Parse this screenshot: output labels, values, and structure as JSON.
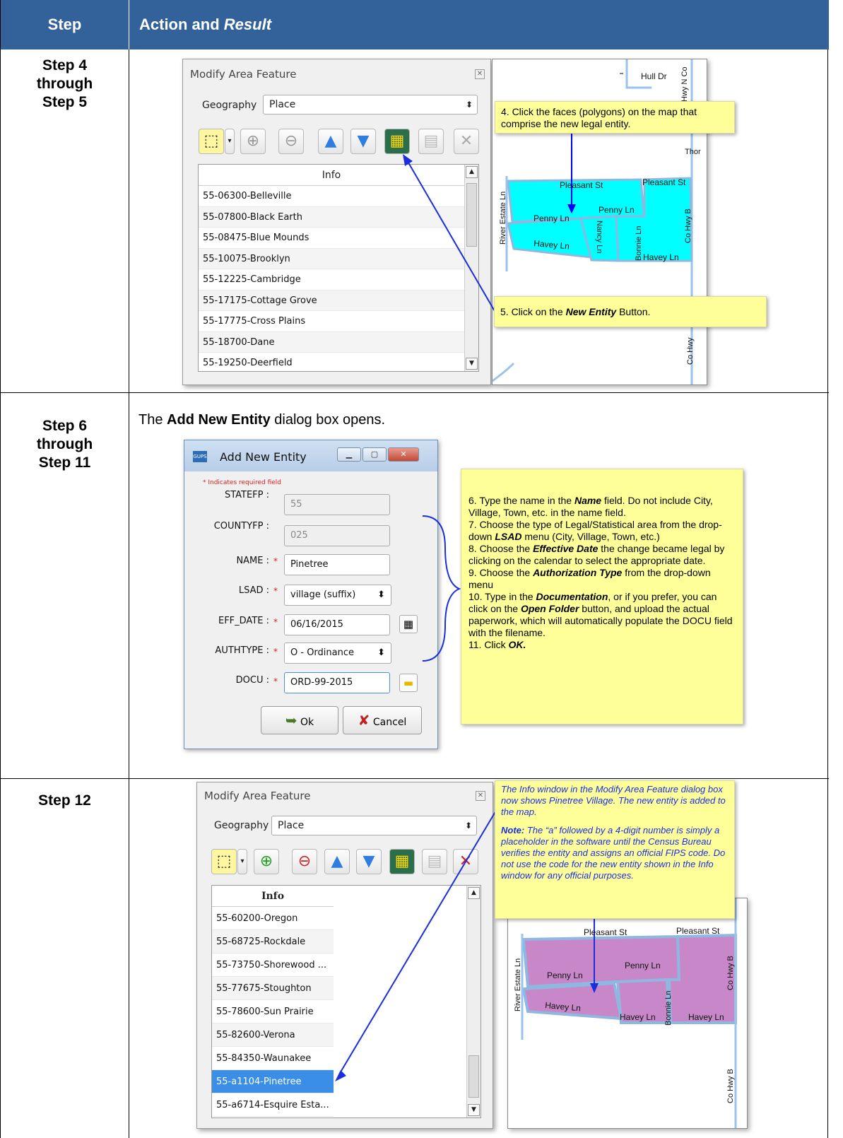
{
  "header": {
    "step": "Step",
    "action_plain": "Action and ",
    "action_italic": "Result"
  },
  "rows": [
    {
      "step_lines": [
        "Step 4",
        "through",
        "Step 5"
      ]
    },
    {
      "step_lines": [
        "Step 6",
        "through",
        "Step 11"
      ]
    },
    {
      "step_lines": [
        "Step 12"
      ]
    }
  ],
  "dialog1": {
    "title": "Modify Area Feature",
    "geography_label": "Geography",
    "geography_value": "Place",
    "list_header": "Info",
    "items": [
      "55-06300-Belleville",
      "55-07800-Black Earth",
      "55-08475-Blue Mounds",
      "55-10075-Brooklyn",
      "55-12225-Cambridge",
      "55-17175-Cottage Grove",
      "55-17775-Cross Plains",
      "55-18700-Dane",
      "55-19250-Deerfield"
    ]
  },
  "map1": {
    "labels": {
      "hull": "Hull Dr",
      "hwy_n": "Hwy N Co",
      "thor": "Thor",
      "pleasant1": "Pleasant St",
      "pleasant2": "Pleasant St",
      "river": "River Estate Ln",
      "penny1": "Penny Ln",
      "penny2": "Penny Ln",
      "nancy": "Nancy Ln",
      "bonnie": "Bonnie Ln",
      "cohwyb": "Co Hwy B",
      "havey1": "Havey Ln",
      "havey2": "Havey Ln",
      "cohwy": "Co Hwy"
    }
  },
  "callouts": {
    "c4": "4.  Click the faces (polygons) on the map that comprise the new legal entity.",
    "c5_pre": "5.  Click on the ",
    "c5_bold": "New Entity",
    "c5_post": " Button."
  },
  "row2": {
    "intro_pre": "The ",
    "intro_bold": "Add New Entity",
    "intro_post": " dialog box opens."
  },
  "add_dialog": {
    "title": "Add New Entity",
    "icon": "GUPS",
    "required_note": "* Indicates required field",
    "fields": [
      {
        "label": "STATEFP :",
        "value": "55"
      },
      {
        "label": "COUNTYFP :",
        "value": "025"
      },
      {
        "label": "NAME :",
        "value": "Pinetree"
      },
      {
        "label": "LSAD :",
        "value": "village (suffix)"
      },
      {
        "label": "EFF_DATE :",
        "value": "06/16/2015"
      },
      {
        "label": "AUTHTYPE :",
        "value": "O - Ordinance"
      },
      {
        "label": "DOCU :",
        "value": "ORD-99-2015"
      }
    ],
    "ok": "Ok",
    "cancel": "Cancel",
    "req_mark": "*"
  },
  "instructions": {
    "l1_pre": "6. Type the name in the ",
    "l1_b": "Name",
    "l1_post": " field. Do not include City, Village, Town, etc. in the name field.",
    "l2_pre": "7. Choose the type of Legal/Statistical  area from the drop-down ",
    "l2_b": "LSAD",
    "l2_post": " menu (City, Village, Town, etc.)",
    "l3_pre": "8. Choose the ",
    "l3_b": "Effective Date",
    "l3_post": " the change became legal by clicking on the calendar to select the appropriate date.",
    "l4_pre": "9. Choose the ",
    "l4_b": "Authorization Type",
    "l4_post": " from the drop-down menu",
    "l5_pre": "10. Type in the ",
    "l5_b": "Documentation",
    "l5_mid": ", or if you prefer, you can click on the ",
    "l5_b2": "Open Folder",
    "l5_post": " button, and upload the actual paperwork, which will automatically populate the DOCU field with the filename.",
    "l6_pre": "11. Click ",
    "l6_b": "OK."
  },
  "dialog3": {
    "title": "Modify Area Feature",
    "geography_label": "Geography",
    "geography_value": "Place",
    "list_header": "Info",
    "items": [
      "55-60200-Oregon",
      "55-68725-Rockdale",
      "55-73750-Shorewood ...",
      "55-77675-Stoughton",
      "55-78600-Sun Prairie",
      "55-82600-Verona",
      "55-84350-Waunakee",
      "55-a1104-Pinetree",
      "55-a6714-Esquire Esta..."
    ]
  },
  "note3": {
    "p1": "The Info window in the Modify Area Feature dialog box now shows Pinetree Village. The new entity is added to the map.",
    "p2_b": "Note:",
    "p2": " The “a” followed by a 4-digit number is simply a placeholder in the software until the Census Bureau verifies the entity and assigns an official FIPS code. Do not use the code for the new entity shown in the Info window for any official purposes."
  },
  "map3": {
    "labels": {
      "pleasant1": "Pleasant St",
      "pleasant2": "Pleasant St",
      "river": "River Estate Ln",
      "penny1": "Penny Ln",
      "penny2": "Penny Ln",
      "bonnie": "Bonnie Ln",
      "cohwyb": "Co Hwy B",
      "havey1": "Havey Ln",
      "havey2": "Havey Ln",
      "havey3": "Havey Ln",
      "cohwyb2": "Co Hwy B"
    }
  },
  "colors": {
    "header": "#33619a",
    "entity_fill": "#00ffff",
    "pinetree_fill": "#c887c8",
    "callout": "#ffff99",
    "selected": "#3a8ee6"
  }
}
